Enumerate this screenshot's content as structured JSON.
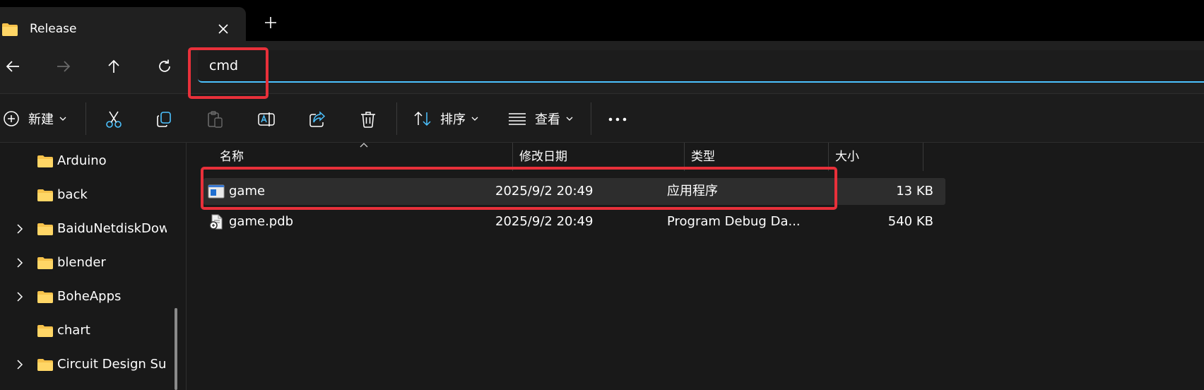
{
  "window": {
    "tab_title": "Release",
    "tab_icon": "folder-icon",
    "new_tab_icon": "plus-icon",
    "close_tab_icon": "close-icon"
  },
  "address_bar": {
    "value": "cmd",
    "accent_color": "#4cc2ff"
  },
  "command_bar": {
    "new_label": "新建",
    "sort_label": "排序",
    "view_label": "查看",
    "icons": [
      "add-circle-icon",
      "cut-icon",
      "copy-icon",
      "paste-icon",
      "rename-icon",
      "share-icon",
      "delete-icon",
      "sort-icon",
      "view-icon",
      "more-icon"
    ]
  },
  "sidebar": {
    "items": [
      {
        "label": "Arduino",
        "expandable": false
      },
      {
        "label": "back",
        "expandable": false
      },
      {
        "label": "BaiduNetdiskDow",
        "expandable": true
      },
      {
        "label": "blender",
        "expandable": true
      },
      {
        "label": "BoheApps",
        "expandable": true
      },
      {
        "label": "chart",
        "expandable": false
      },
      {
        "label": "Circuit Design Sui",
        "expandable": true
      }
    ]
  },
  "file_list": {
    "columns": {
      "name": "名称",
      "date": "修改日期",
      "type": "类型",
      "size": "大小"
    },
    "rows": [
      {
        "name": "game",
        "date": "2025/9/2 20:49",
        "type": "应用程序",
        "size": "13 KB",
        "icon": "application-icon",
        "selected": true
      },
      {
        "name": "game.pdb",
        "date": "2025/9/2 20:49",
        "type": "Program Debug Da...",
        "size": "540 KB",
        "icon": "pdb-file-icon",
        "selected": false
      }
    ]
  },
  "annotations": {
    "highlight_color": "#e8303a"
  }
}
